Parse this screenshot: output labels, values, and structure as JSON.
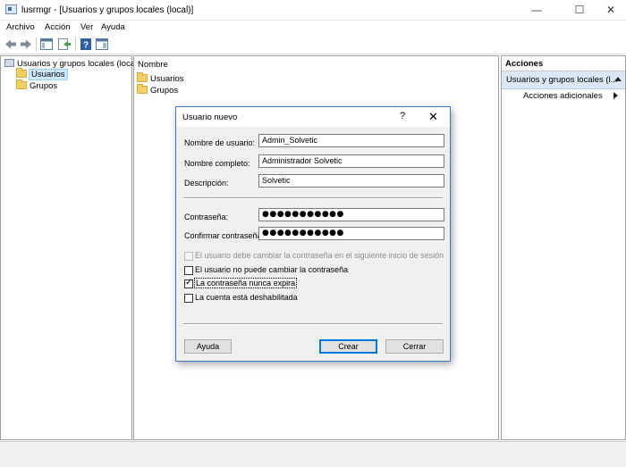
{
  "window": {
    "title": "lusrmgr - [Usuarios y grupos locales (local)]",
    "minimize_glyph": "—",
    "maximize_glyph": "☐",
    "close_glyph": "✕"
  },
  "menu": [
    "Archivo",
    "Acción",
    "Ver",
    "Ayuda"
  ],
  "toolbar": {
    "icons": [
      "back-arrow-icon",
      "forward-arrow-icon",
      "show-tree-icon",
      "export-list-icon",
      "help-icon",
      "properties-icon"
    ]
  },
  "tree": {
    "root": "Usuarios y grupos locales (local)",
    "items": [
      "Usuarios",
      "Grupos"
    ],
    "selected": "Usuarios"
  },
  "list": {
    "column_header": "Nombre",
    "items": [
      "Usuarios",
      "Grupos"
    ]
  },
  "actions": {
    "header": "Acciones",
    "section": "Usuarios y grupos locales (l...",
    "more": "Acciones adicionales"
  },
  "dialog": {
    "title": "Usuario nuevo",
    "help_glyph": "?",
    "close_glyph": "✕",
    "fields": {
      "username_label": "Nombre de usuario:",
      "username_value": "Admin_Solvetic",
      "fullname_label": "Nombre completo:",
      "fullname_value": "Administrador Solvetic",
      "description_label": "Descripción:",
      "description_value": "Solvetic",
      "password_label": "Contraseña:",
      "password_value": "●●●●●●●●●●●",
      "confirm_label": "Confirmar contraseña:",
      "confirm_value": "●●●●●●●●●●●"
    },
    "checkboxes": [
      {
        "label": "El usuario debe cambiar la contraseña en el siguiente inicio de sesión",
        "checked": false,
        "disabled": true
      },
      {
        "label": "El usuario no puede cambiar la contraseña",
        "checked": false,
        "disabled": false
      },
      {
        "label": "La contraseña nunca expira",
        "checked": true,
        "disabled": false
      },
      {
        "label": "La cuenta está deshabilitada",
        "checked": false,
        "disabled": false
      }
    ],
    "buttons": {
      "help": "Ayuda",
      "create": "Crear",
      "close": "Cerrar"
    }
  }
}
